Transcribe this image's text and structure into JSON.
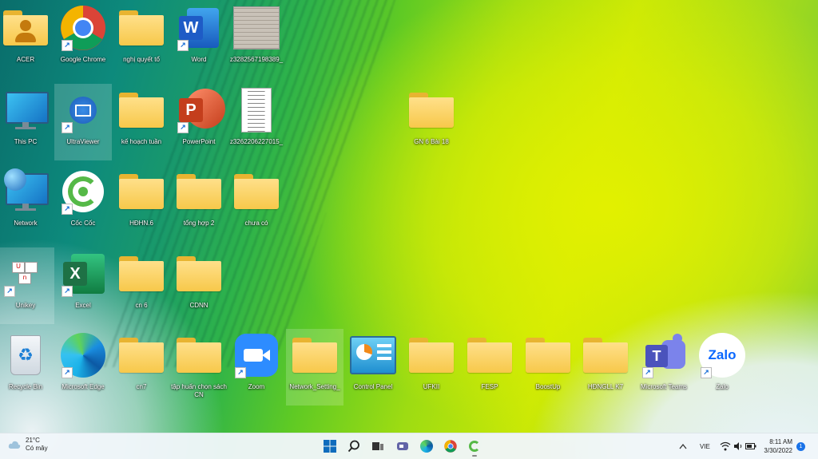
{
  "desktop": {
    "icons": [
      {
        "label": "ACER"
      },
      {
        "label": "Google Chrome"
      },
      {
        "label": "nghị quyết tổ"
      },
      {
        "label": "Word"
      },
      {
        "label": "z3282567198389_"
      },
      {
        "label": "This PC"
      },
      {
        "label": "UltraViewer"
      },
      {
        "label": "kế hoạch tuần"
      },
      {
        "label": "PowerPoint"
      },
      {
        "label": "z3262206227015_"
      },
      {
        "label": "GN 6 Bài 18"
      },
      {
        "label": "Network"
      },
      {
        "label": "Cốc Cốc"
      },
      {
        "label": "HĐHN.6"
      },
      {
        "label": "tổng hợp 2"
      },
      {
        "label": "chưa có"
      },
      {
        "label": "Unikey"
      },
      {
        "label": "Excel"
      },
      {
        "label": "cn 6"
      },
      {
        "label": "CDNN"
      },
      {
        "label": "Recycle Bin"
      },
      {
        "label": "Microsoft Edge"
      },
      {
        "label": "cn7"
      },
      {
        "label": "tập huấn chọn sách CN"
      },
      {
        "label": "Zoom"
      },
      {
        "label": "Network_Setting_"
      },
      {
        "label": "Control Panel"
      },
      {
        "label": "UFKII"
      },
      {
        "label": "FESP"
      },
      {
        "label": "BoostUp"
      },
      {
        "label": "HĐNGLL K7"
      },
      {
        "label": "Microsoft Teams"
      },
      {
        "label": "Zalo"
      }
    ]
  },
  "taskbar": {
    "weather_temp": "21°C",
    "weather_desc": "Có mây",
    "language": "VIE",
    "time": "8:11 AM",
    "date": "3/30/2022",
    "notification_count": "1"
  },
  "colors": {
    "folder": "#f7c84a",
    "word": "#1e5bc6",
    "powerpoint": "#d24726",
    "excel": "#1e7145",
    "zoom": "#2d8cff",
    "teams": "#5b5fc7",
    "zalo": "#0a68ff"
  }
}
